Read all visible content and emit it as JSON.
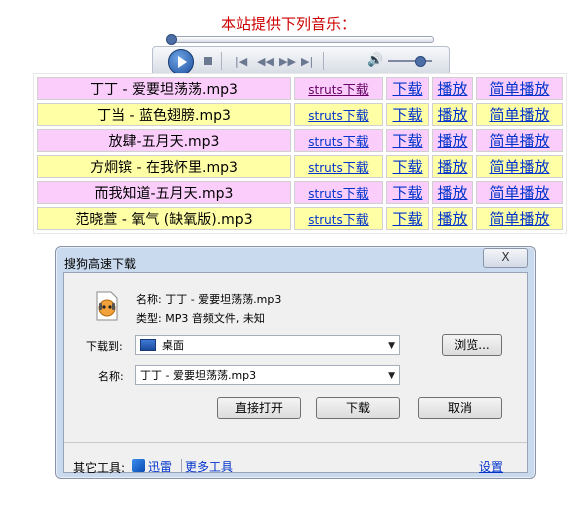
{
  "header": {
    "title": "本站提供下列音乐："
  },
  "player": {
    "icons": [
      "play-icon",
      "stop-icon",
      "previous-icon",
      "rewind-icon",
      "fast-forward-icon",
      "next-icon",
      "volume-icon"
    ],
    "glyphs": {
      "prev": "|◀",
      "rew": "◀◀",
      "ffw": "▶▶",
      "next": "▶|",
      "vol": "🔊"
    }
  },
  "songs": [
    {
      "name": "丁丁 - 爱要坦荡荡.mp3",
      "struts_prefix": "struts",
      "struts_suffix": "下载",
      "download": "下载",
      "play": "播放",
      "simple_play": "简单播放",
      "color": "pink"
    },
    {
      "name": "丁当 - 蓝色翅膀.mp3",
      "struts_prefix": "struts",
      "struts_suffix": "下载",
      "download": "下载",
      "play": "播放",
      "simple_play": "简单播放",
      "color": "yellow"
    },
    {
      "name": "放肆-五月天.mp3",
      "struts_prefix": "struts",
      "struts_suffix": "下载",
      "download": "下载",
      "play": "播放",
      "simple_play": "简单播放",
      "color": "pink"
    },
    {
      "name": "方炯镔 - 在我怀里.mp3",
      "struts_prefix": "struts",
      "struts_suffix": "下载",
      "download": "下载",
      "play": "播放",
      "simple_play": "简单播放",
      "color": "yellow"
    },
    {
      "name": "而我知道-五月天.mp3",
      "struts_prefix": "struts",
      "struts_suffix": "下载",
      "download": "下载",
      "play": "播放",
      "simple_play": "简单播放",
      "color": "pink"
    },
    {
      "name": "范晓萱 - 氧气 (缺氧版).mp3",
      "struts_prefix": "struts",
      "struts_suffix": "下载",
      "download": "下载",
      "play": "播放",
      "simple_play": "简单播放",
      "color": "yellow"
    }
  ],
  "dialog": {
    "title": "搜狗高速下载",
    "close_label": "X",
    "file_name_label": "名称:",
    "file_name": "丁丁 - 爱要坦荡荡.mp3",
    "file_type_label": "类型:",
    "file_type": "MP3 音频文件, 未知",
    "save_to_label": "下载到:",
    "save_to_value": "桌面",
    "browse_button": "浏览...",
    "name_label": "名称:",
    "name_value": "丁丁 - 爱要坦荡荡.mp3",
    "open_button": "直接打开",
    "download_button": "下载",
    "cancel_button": "取消",
    "tools_label": "其它工具:",
    "xunlei_link": "迅雷",
    "more_tools_link": "更多工具",
    "settings_link": "设置",
    "dropdown_arrow": "▼"
  }
}
